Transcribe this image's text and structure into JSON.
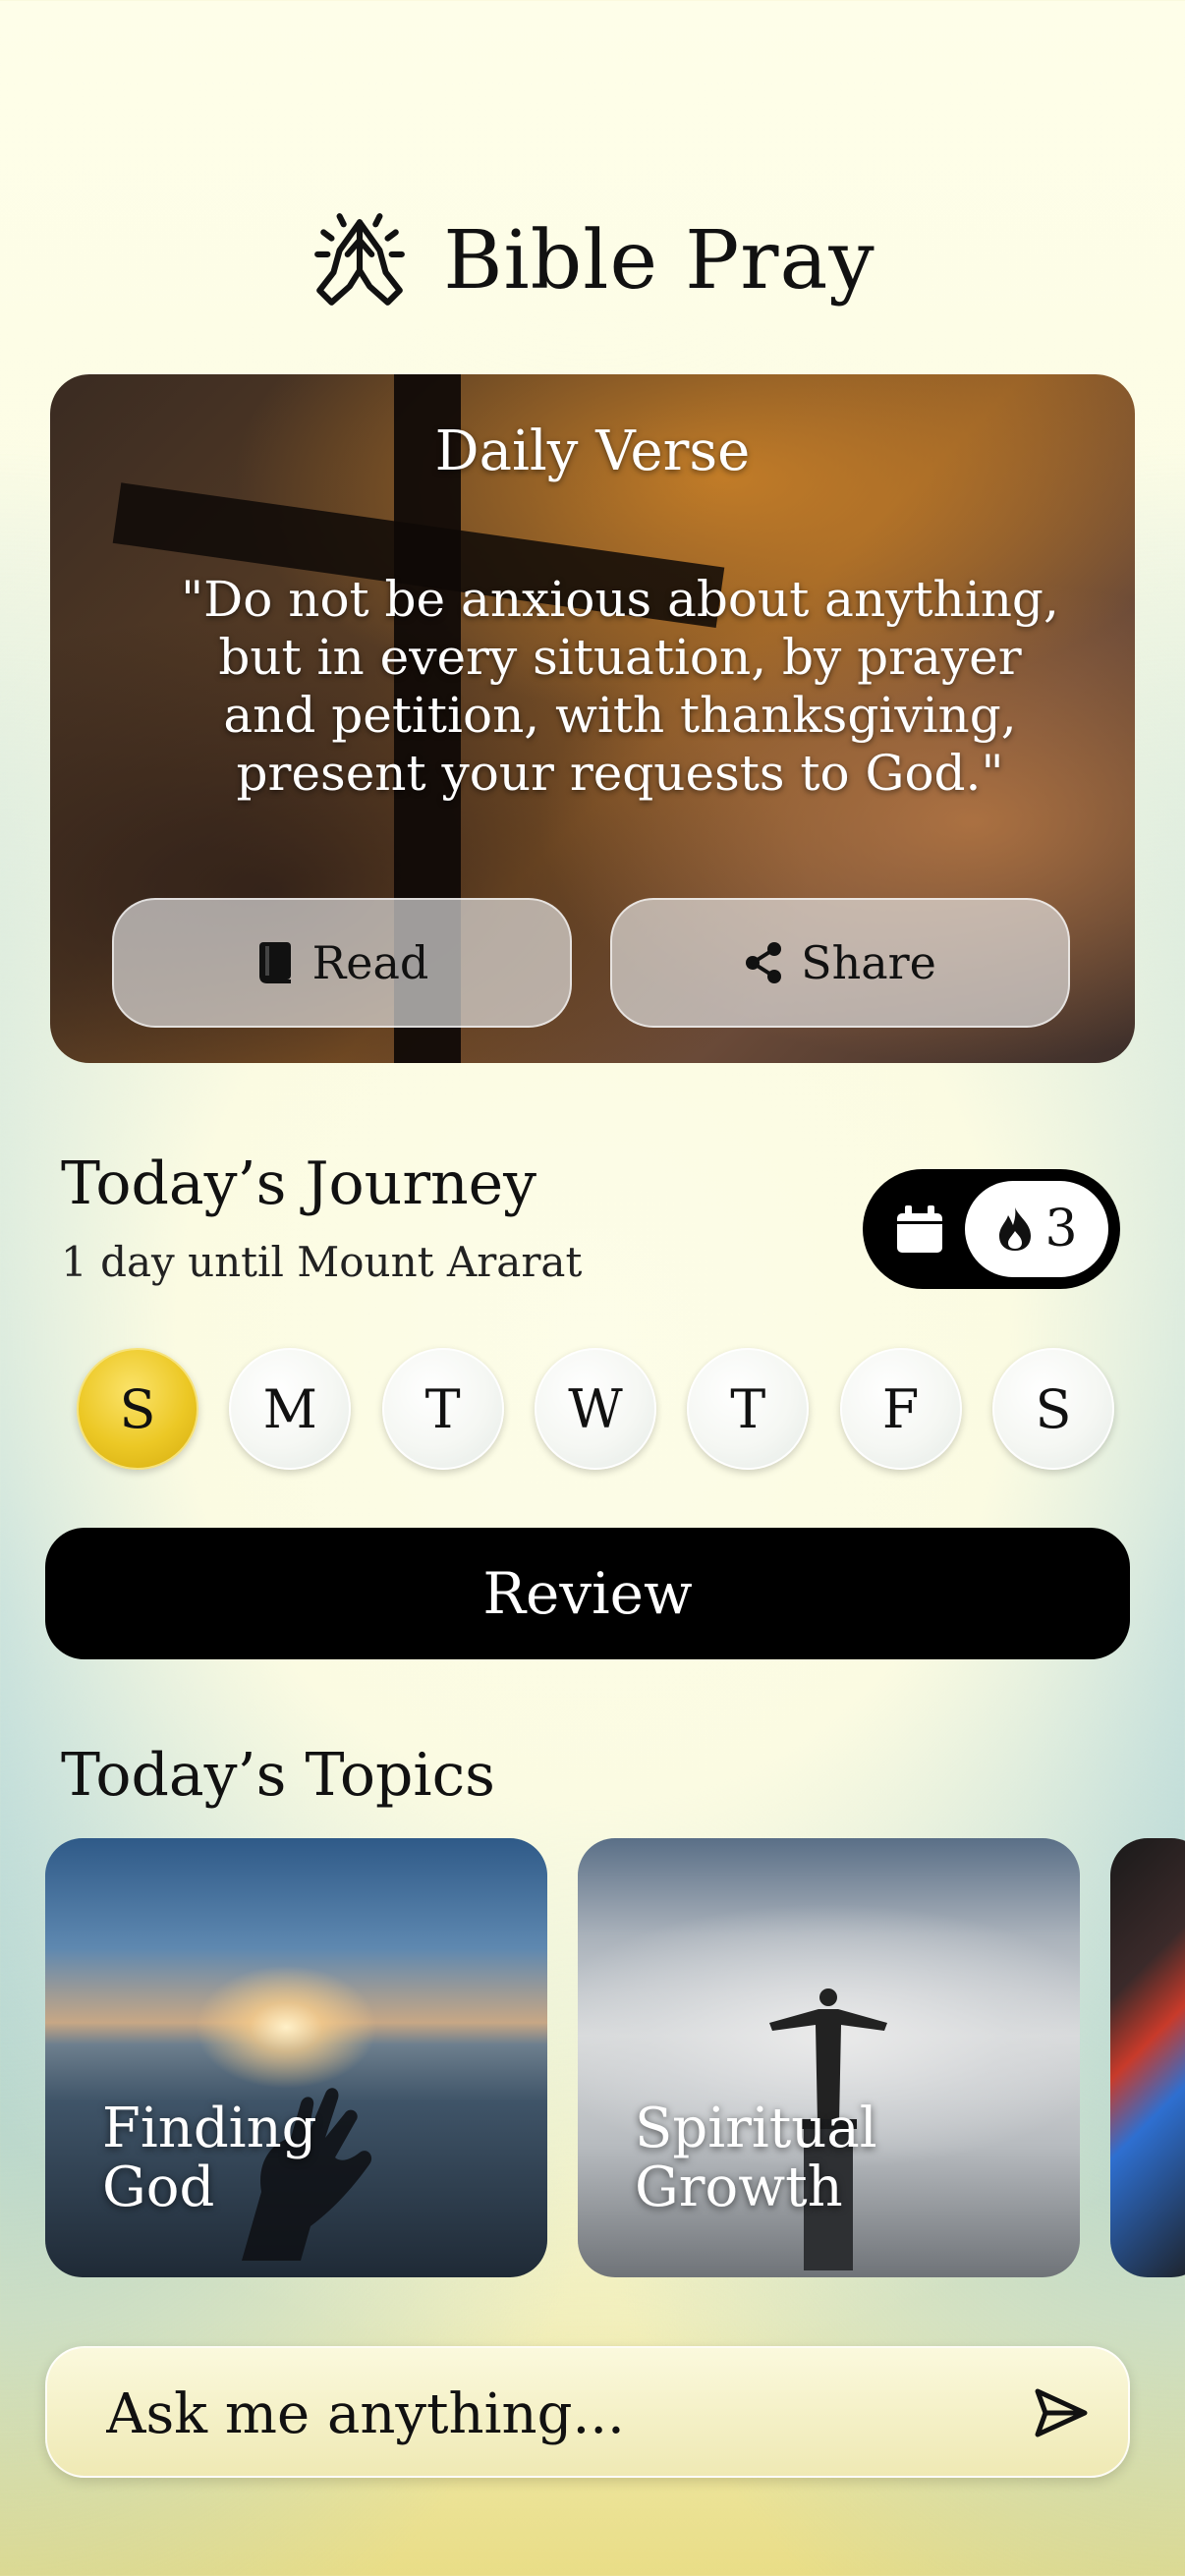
{
  "header": {
    "title": "Bible Pray",
    "icon": "praying-hands-icon"
  },
  "daily_verse": {
    "title": "Daily Verse",
    "text": "\"Do not be anxious about anything, but in every situation, by prayer and petition, with thanksgiving, present your requests to God.\"",
    "read_label": "Read",
    "share_label": "Share"
  },
  "journey": {
    "title": "Today’s Journey",
    "subtitle": "1 day until Mount Ararat",
    "streak_count": "3",
    "days": [
      {
        "label": "S",
        "active": true
      },
      {
        "label": "M",
        "active": false
      },
      {
        "label": "T",
        "active": false
      },
      {
        "label": "W",
        "active": false
      },
      {
        "label": "T",
        "active": false
      },
      {
        "label": "F",
        "active": false
      },
      {
        "label": "S",
        "active": false
      }
    ],
    "review_label": "Review",
    "accent_color": "#ecc825"
  },
  "topics": {
    "title": "Today’s Topics",
    "items": [
      {
        "label": "Finding God"
      },
      {
        "label": "Spiritual Growth"
      },
      {
        "label": ""
      }
    ]
  },
  "ask": {
    "placeholder": "Ask me anything..."
  }
}
